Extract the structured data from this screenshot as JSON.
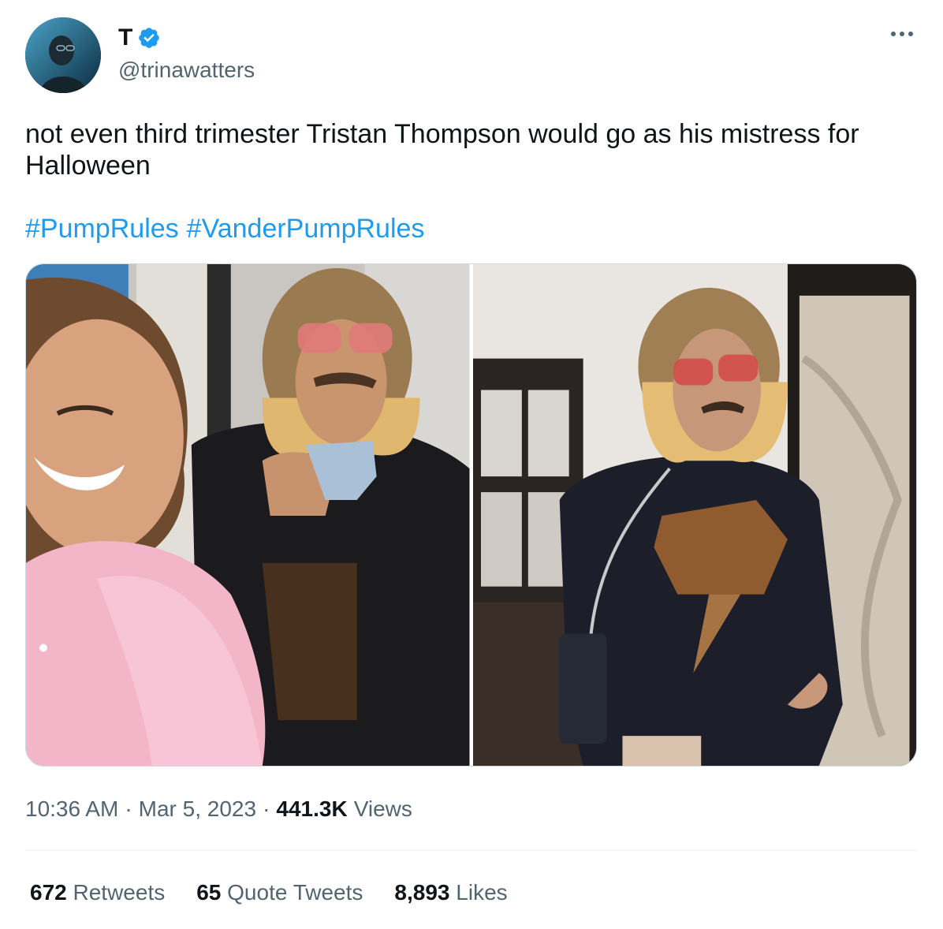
{
  "author": {
    "display_name": "T",
    "handle": "@trinawatters",
    "verified": true,
    "avatar_icon": "avatar-photo"
  },
  "tweet": {
    "text": "not even third trimester Tristan Thompson would go as his mistress for Halloween",
    "hashtags": [
      "#PumpRules",
      "#VanderPumpRules"
    ]
  },
  "media": [
    {
      "description_icon": "photo-selfie-two-people"
    },
    {
      "description_icon": "photo-costume-standing"
    }
  ],
  "meta": {
    "time": "10:36 AM",
    "separator": "·",
    "date": "Mar 5, 2023",
    "views_count": "441.3K",
    "views_label": "Views"
  },
  "stats": {
    "retweets_count": "672",
    "retweets_label": "Retweets",
    "quotes_count": "65",
    "quotes_label": "Quote Tweets",
    "likes_count": "8,893",
    "likes_label": "Likes"
  },
  "colors": {
    "link": "#1d9bf0",
    "secondary_text": "#536471",
    "primary_text": "#0f1419",
    "verified": "#1d9bf0"
  }
}
